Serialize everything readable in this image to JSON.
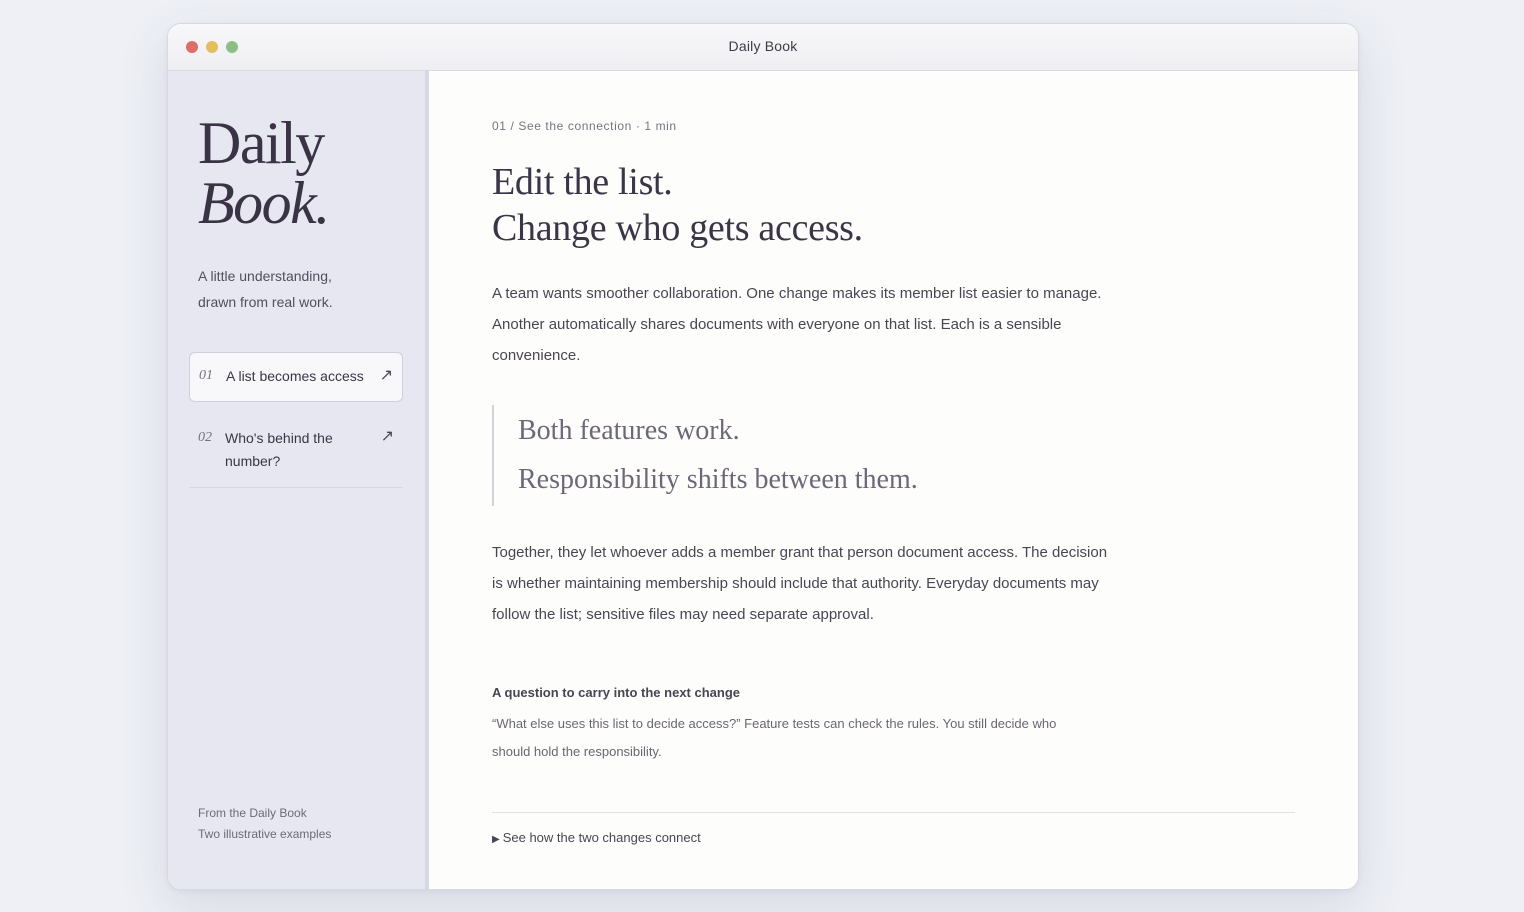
{
  "window": {
    "title": "Daily Book"
  },
  "sidebar": {
    "logo_line1": "Daily",
    "logo_line2": "Book.",
    "tagline_line1": "A little understanding,",
    "tagline_line2": "drawn from real work.",
    "items": [
      {
        "number": "01",
        "label": "A list becomes access",
        "arrow": "↗"
      },
      {
        "number": "02",
        "label": "Who's behind the number?",
        "arrow": "↗"
      }
    ],
    "footer_line1": "From the Daily Book",
    "footer_line2": "Two illustrative examples"
  },
  "main": {
    "eyebrow": "01 / See the connection · 1 min",
    "headline_line1": "Edit the list.",
    "headline_line2": "Change who gets access.",
    "intro": "A team wants smoother collaboration. One change makes its member list easier to manage. Another automatically shares documents with everyone on that list. Each is a sensible convenience.",
    "quote_line1": "Both features work.",
    "quote_line2": "Responsibility shifts between them.",
    "body": "Together, they let whoever adds a member grant that person document access. The decision is whether maintaining membership should include that authority. Everyday documents may follow the list; sensitive files may need separate approval.",
    "question_title": "A question to carry into the next change",
    "question_body": "“What else uses this list to decide access?” Feature tests can check the rules. You still decide who should hold the responsibility.",
    "details_marker": "▶",
    "details_label": "See how the two changes connect"
  }
}
